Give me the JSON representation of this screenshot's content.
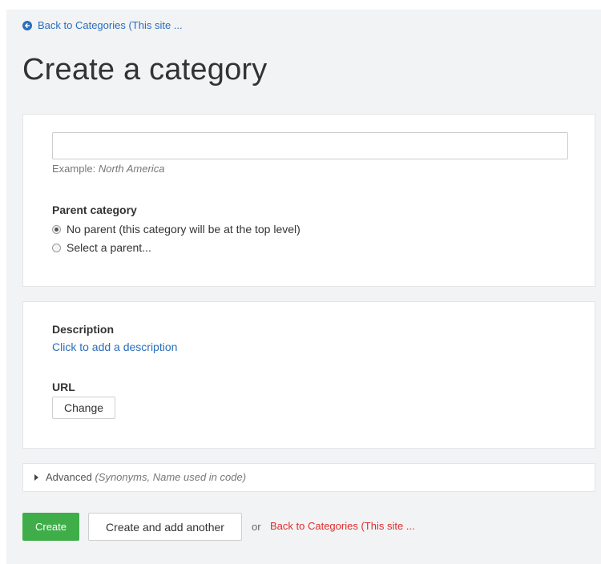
{
  "nav": {
    "back_link": "Back to Categories (This site ..."
  },
  "page": {
    "title": "Create a category"
  },
  "form": {
    "name_value": "",
    "example_prefix": "Example:",
    "example_value": "North America",
    "parent_label": "Parent category",
    "parent_options": [
      {
        "label": "No parent (this category will be at the top level)",
        "selected": true
      },
      {
        "label": "Select a parent...",
        "selected": false
      }
    ],
    "description_label": "Description",
    "description_link": "Click to add a description",
    "url_label": "URL",
    "url_button": "Change",
    "advanced_label": "Advanced",
    "advanced_hint": "(Synonyms, Name used in code)"
  },
  "actions": {
    "create": "Create",
    "create_another": "Create and add another",
    "or": "or",
    "back_link": "Back to Categories (This site ..."
  },
  "colors": {
    "link": "#2a6ebb",
    "create_bg": "#3fae49",
    "back_red": "#e02b2b",
    "page_bg": "#f2f3f5"
  },
  "icons": {
    "back": "circle-arrow-left-icon",
    "advanced": "caret-right-icon"
  }
}
